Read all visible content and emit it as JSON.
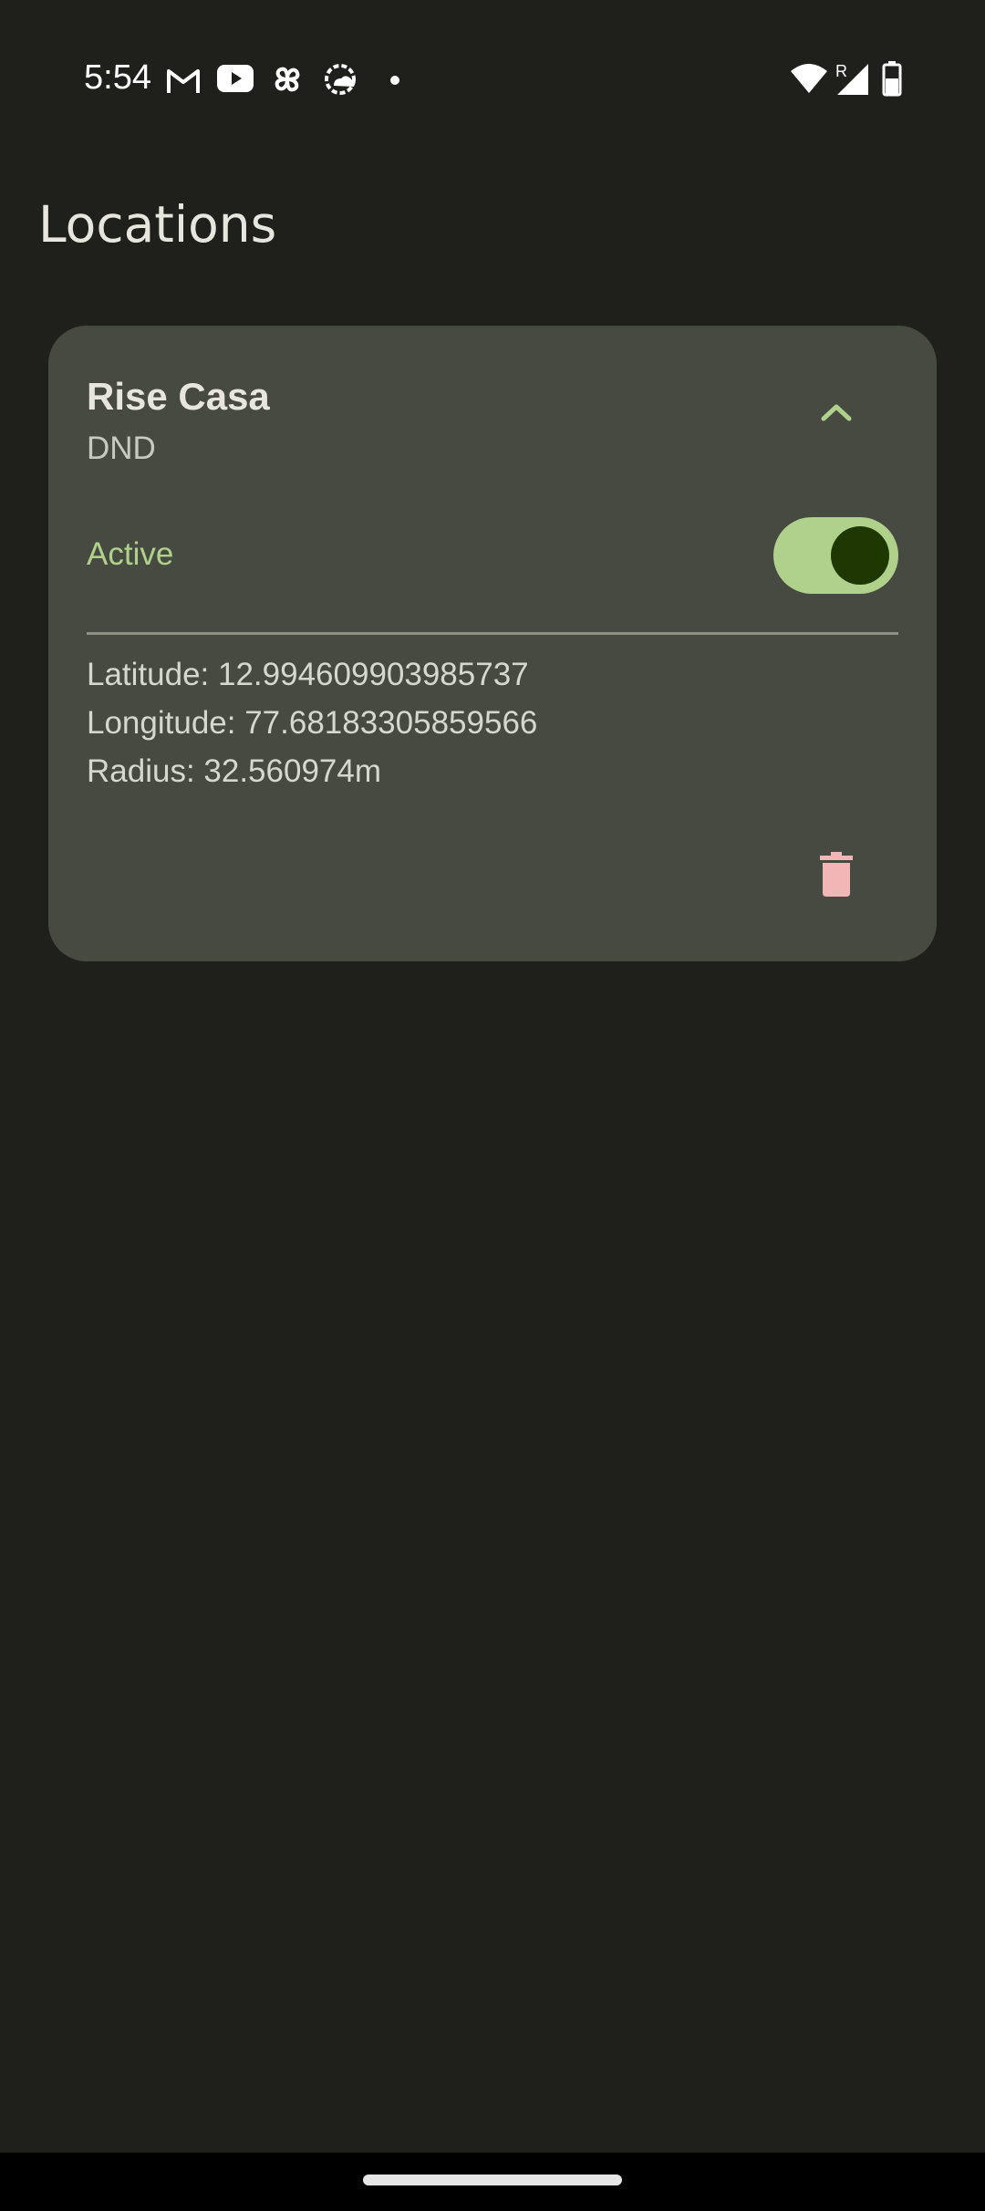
{
  "status_bar": {
    "time": "5:54",
    "left_icons": [
      "gmail-icon",
      "youtube-icon",
      "pinwheel-icon",
      "weather-icon",
      "notification-dot-icon"
    ],
    "right_icons": [
      "wifi-icon",
      "signal-roaming-icon",
      "battery-icon"
    ],
    "roaming_indicator": "R"
  },
  "app_bar": {
    "title": "Locations"
  },
  "location_card": {
    "name": "Rise Casa",
    "mode": "DND",
    "active_label": "Active",
    "active": true,
    "latitude_text": "Latitude: 12.994609903985737",
    "longitude_text": "Longitude: 77.68183305859566",
    "radius_text": "Radius: 32.560974m"
  },
  "colors": {
    "background": "#1f201b",
    "card": "#474a40",
    "accent_green": "#b0d18b",
    "delete_pink": "#f3b6b6"
  }
}
